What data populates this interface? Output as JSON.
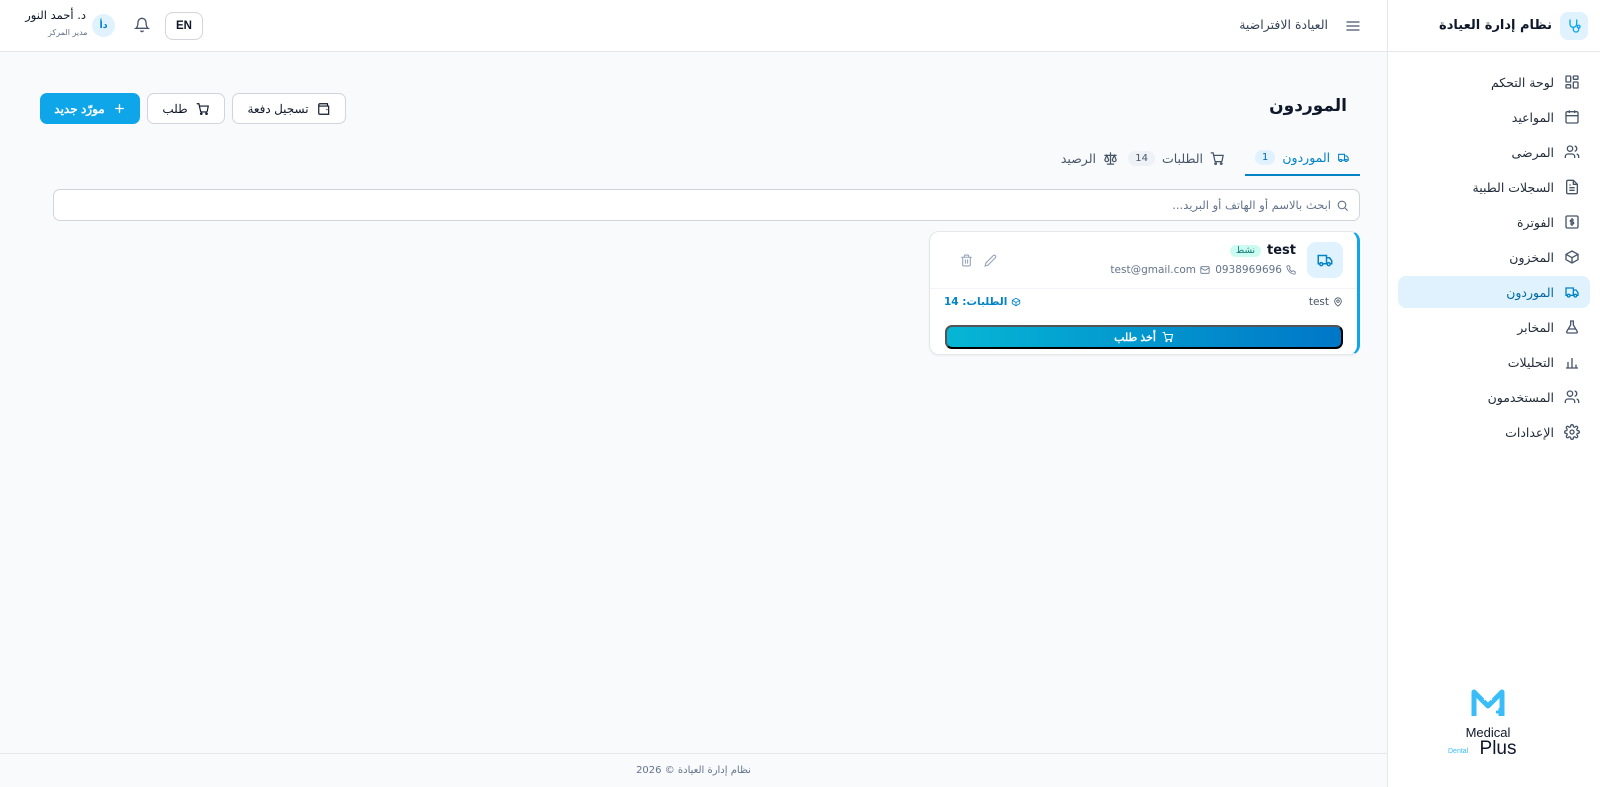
{
  "sidebar": {
    "brand": "نظام إدارة العيادة",
    "items": [
      {
        "label": "لوحة التحكم",
        "icon": "dashboard-icon"
      },
      {
        "label": "المواعيد",
        "icon": "calendar-icon"
      },
      {
        "label": "المرضى",
        "icon": "users-icon"
      },
      {
        "label": "السجلات الطبية",
        "icon": "document-icon"
      },
      {
        "label": "الفوترة",
        "icon": "dollar-icon"
      },
      {
        "label": "المخزون",
        "icon": "box-icon"
      },
      {
        "label": "الموردون",
        "icon": "truck-icon",
        "active": true
      },
      {
        "label": "المخابر",
        "icon": "flask-icon"
      },
      {
        "label": "التحليلات",
        "icon": "bar-chart-icon"
      },
      {
        "label": "المستخدمون",
        "icon": "users-icon"
      },
      {
        "label": "الإعدادات",
        "icon": "gear-icon"
      }
    ],
    "logo": {
      "word1": "Medical",
      "word2": "Plus",
      "word3": "Dental"
    }
  },
  "header": {
    "clinic_name": "العيادة الافتراضية",
    "language": "EN",
    "user": {
      "initials": "دأ",
      "name": "د. أحمد النور",
      "role": "مدير المركز"
    }
  },
  "main": {
    "title": "الموردون",
    "buttons": {
      "new_supplier": "مورّد جديد",
      "order": "طلب",
      "record_payment": "تسجيل دفعة"
    },
    "tabs": [
      {
        "label": "الموردون",
        "count": "1",
        "active": true
      },
      {
        "label": "الطلبات",
        "count": "14"
      },
      {
        "label": "الرصيد"
      }
    ],
    "search": {
      "placeholder": "ابحث بالاسم أو الهاتف أو البريد..."
    },
    "supplier": {
      "name": "test",
      "status": "نشط",
      "phone": "0938969696",
      "email": "test@gmail.com",
      "address": "test",
      "orders": "الطلبات: 14",
      "action": "أخذ طلب"
    }
  },
  "footer": {
    "text": "نظام إدارة العيادة © 2026"
  },
  "colors": {
    "accent": "#0ea5e9",
    "accent_dark": "#0284c7",
    "active_bg": "#e0f2fe",
    "status_bg": "#ccfbf1"
  }
}
